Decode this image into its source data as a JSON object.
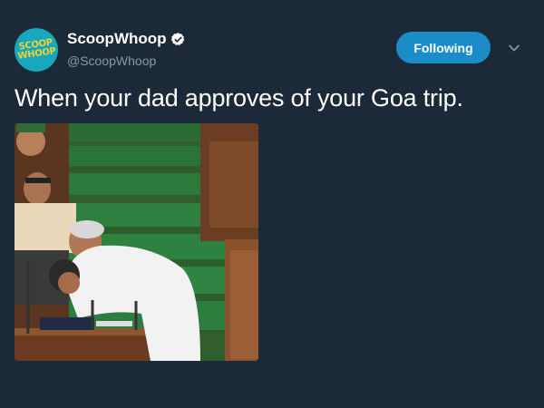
{
  "account": {
    "avatar_text": "SCOOP\nWHOOP",
    "display_name": "ScoopWhoop",
    "handle": "@ScoopWhoop",
    "verified": true
  },
  "follow_button": {
    "label": "Following"
  },
  "tweet": {
    "text": "When your dad approves of your Goa trip.",
    "media_description_icon": "photo"
  },
  "colors": {
    "background": "#1c2938",
    "accent": "#1a8cc7",
    "secondary_text": "#8899a6"
  }
}
